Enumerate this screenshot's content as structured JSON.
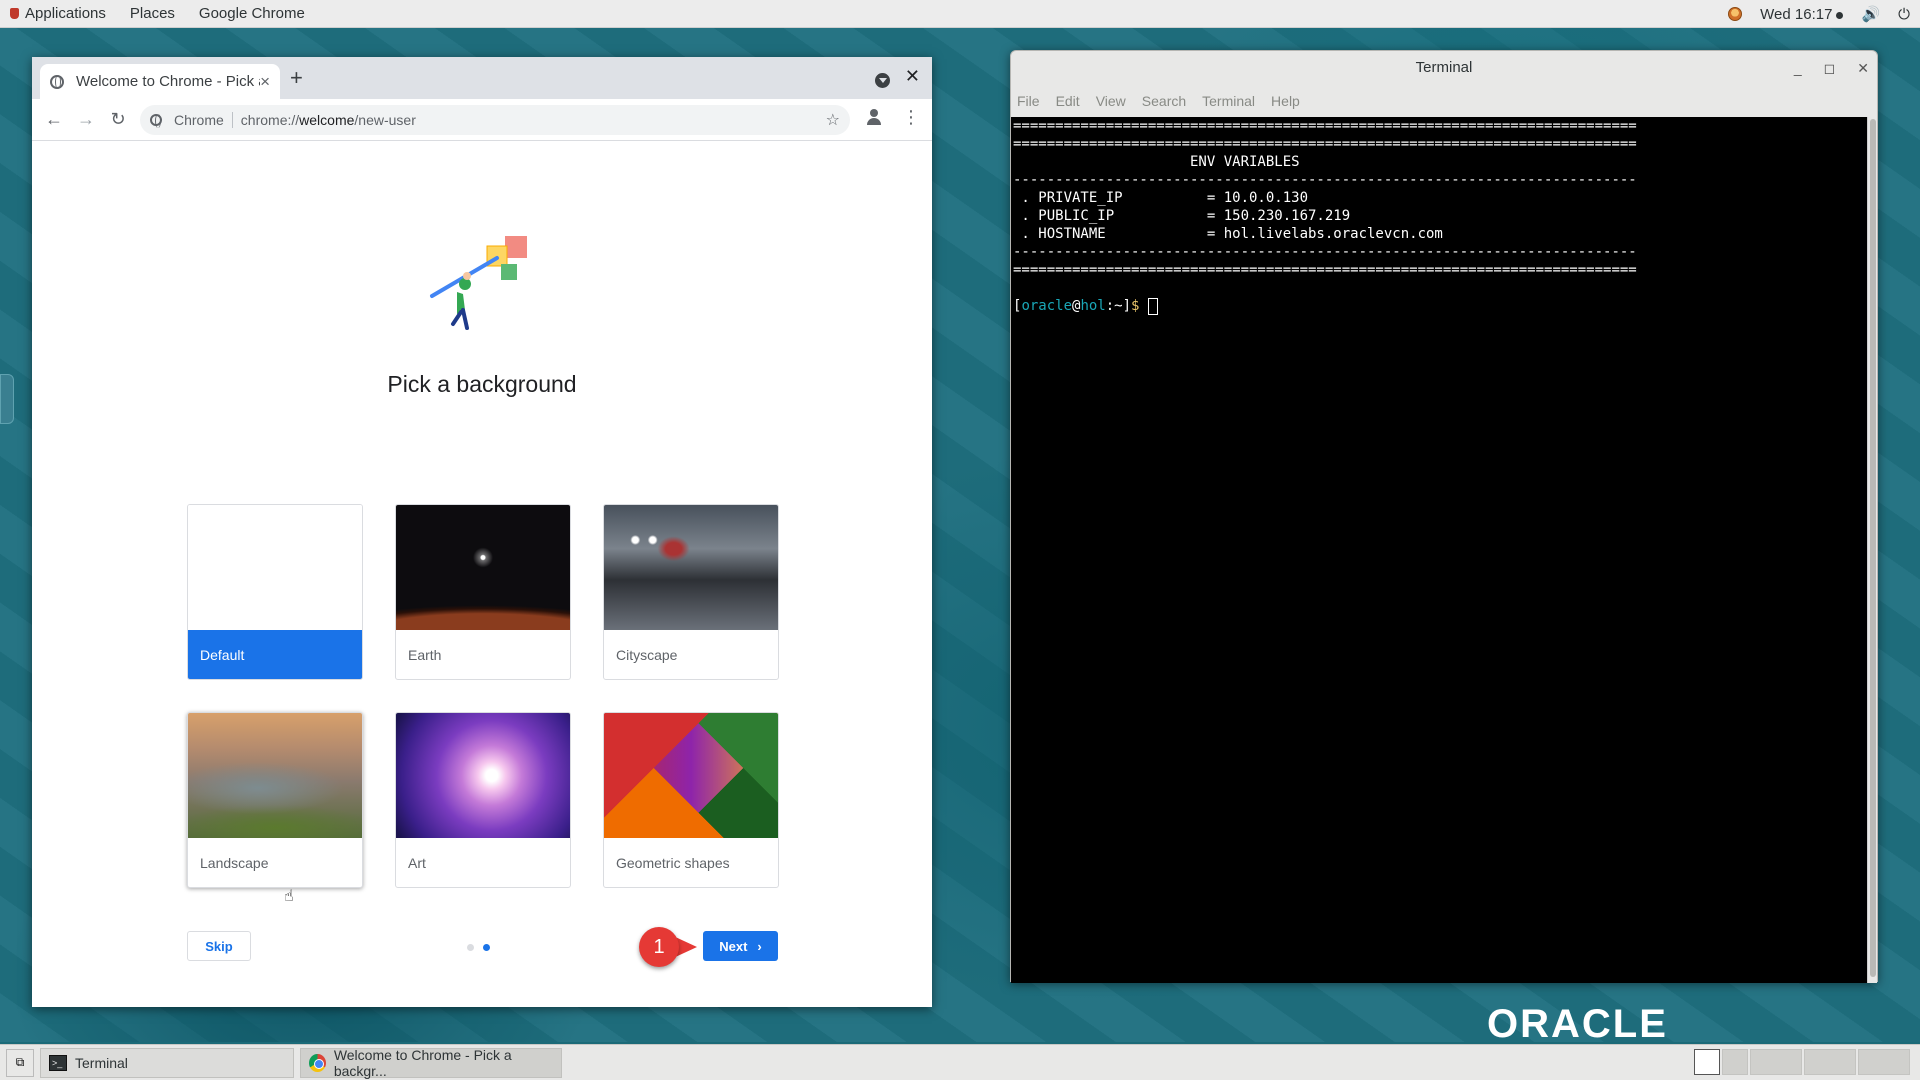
{
  "topbar": {
    "applications": "Applications",
    "places": "Places",
    "app_name": "Google Chrome",
    "clock": "Wed 16:17"
  },
  "chrome": {
    "tab_title": "Welcome to Chrome - Pick a background",
    "new_tab": "+",
    "tab_close": "×",
    "window_close": "✕",
    "omnibox_site": "Chrome",
    "url_prefix": "chrome://",
    "url_host": "welcome",
    "url_path": "/new-user",
    "page": {
      "title": "Pick a background",
      "backgrounds": [
        {
          "label": "Default",
          "selected": true
        },
        {
          "label": "Earth",
          "selected": false
        },
        {
          "label": "Cityscape",
          "selected": false
        },
        {
          "label": "Landscape",
          "selected": false
        },
        {
          "label": "Art",
          "selected": false
        },
        {
          "label": "Geometric shapes",
          "selected": false
        }
      ],
      "skip_label": "Skip",
      "next_label": "Next",
      "callout_number": "1",
      "pager": {
        "count": 2,
        "active_index": 1
      }
    }
  },
  "terminal": {
    "title": "Terminal",
    "menu": [
      "File",
      "Edit",
      "View",
      "Search",
      "Terminal",
      "Help"
    ],
    "lines": [
      "==========================================================================",
      "==========================================================================",
      "                     ENV VARIABLES",
      "--------------------------------------------------------------------------",
      " . PRIVATE_IP          = 10.0.0.130",
      " . PUBLIC_IP           = 150.230.167.219",
      " . HOSTNAME            = hol.livelabs.oraclevcn.com",
      "--------------------------------------------------------------------------",
      "==========================================================================",
      ""
    ],
    "prompt": {
      "open": "[",
      "user": "oracle",
      "at": "@",
      "host": "hol",
      "path": ":~]",
      "dollar": "$"
    }
  },
  "desktop": {
    "logo": "ORACLE"
  },
  "taskbar": {
    "tasks": [
      {
        "label": "Terminal"
      },
      {
        "label": "Welcome to Chrome - Pick a backgr..."
      }
    ]
  },
  "colors": {
    "accent": "#1a73e8",
    "callout": "#e53935",
    "desktop": "#1f7080"
  }
}
